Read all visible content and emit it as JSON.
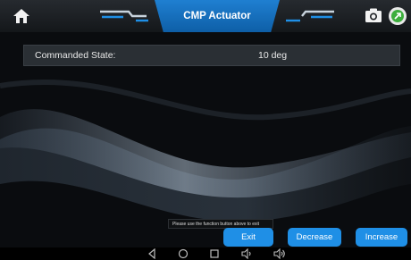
{
  "header": {
    "title": "CMP Actuator",
    "icons": [
      "home-icon",
      "camera-icon",
      "navigation-icon"
    ]
  },
  "data_row": {
    "label": "Commanded State:",
    "value": "10 deg"
  },
  "hint": "Please use the function button above to exit",
  "buttons": {
    "exit": "Exit",
    "decrease": "Decrease",
    "increase": "Increase"
  },
  "system_nav": [
    "back-icon",
    "home-circle-icon",
    "recents-icon",
    "volume-down-icon",
    "volume-up-icon"
  ],
  "colors": {
    "accent": "#1f8fe6",
    "title_tab": "#1577c8",
    "nav_button": "#3cae3c"
  }
}
